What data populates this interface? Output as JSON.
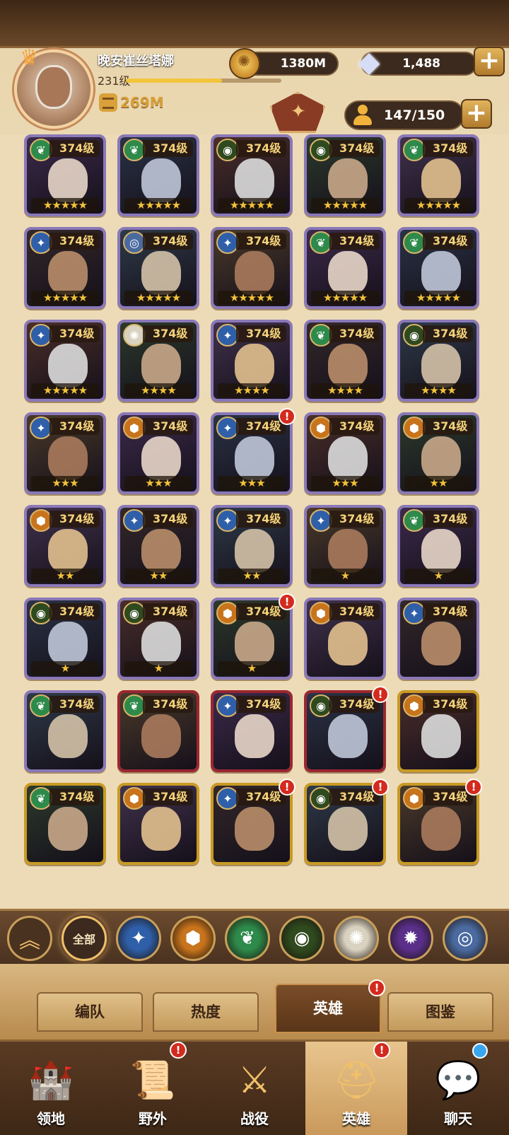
{
  "player": {
    "name": "晚安崔丝塔娜",
    "level": "231级",
    "xp_fraction": 0.62,
    "power": "269M"
  },
  "resources": {
    "gold": "1380M",
    "gems": "1,488"
  },
  "hero_count": "147/150",
  "colors": {
    "lightbearer": "#2f5fa8",
    "mauler": "#c8741c",
    "wilder": "#2e8a4a",
    "graveborn": "#2f4a1e",
    "celestial": "#d9d2c0",
    "hypogean": "#5a2f8a",
    "dimensional": "#4a6aa0",
    "card_bg": "#ecdbb6"
  },
  "heroes": [
    {
      "level": "374级",
      "faction": "wilder",
      "stars": "★★★★★",
      "frame": "purple",
      "alert": false
    },
    {
      "level": "374级",
      "faction": "wilder",
      "stars": "★★★★★",
      "frame": "purple",
      "alert": false
    },
    {
      "level": "374级",
      "faction": "graveborn",
      "stars": "★★★★★",
      "frame": "purple",
      "alert": false
    },
    {
      "level": "374级",
      "faction": "graveborn",
      "stars": "★★★★★",
      "frame": "purple",
      "alert": false
    },
    {
      "level": "374级",
      "faction": "wilder",
      "stars": "★★★★★",
      "frame": "purple",
      "alert": false
    },
    {
      "level": "374级",
      "faction": "lightbearer",
      "stars": "★★★★★",
      "frame": "purple",
      "alert": false
    },
    {
      "level": "374级",
      "faction": "dimensional",
      "stars": "★★★★★",
      "frame": "purple",
      "alert": false
    },
    {
      "level": "374级",
      "faction": "lightbearer",
      "stars": "★★★★★",
      "frame": "purple",
      "alert": false
    },
    {
      "level": "374级",
      "faction": "wilder",
      "stars": "★★★★★",
      "frame": "purple",
      "alert": false
    },
    {
      "level": "374级",
      "faction": "wilder",
      "stars": "★★★★★",
      "frame": "purple",
      "alert": false
    },
    {
      "level": "374级",
      "faction": "lightbearer",
      "stars": "★★★★★",
      "frame": "purple",
      "alert": false
    },
    {
      "level": "374级",
      "faction": "celestial",
      "stars": "★★★★",
      "frame": "purple",
      "alert": false
    },
    {
      "level": "374级",
      "faction": "lightbearer",
      "stars": "★★★★",
      "frame": "purple",
      "alert": false
    },
    {
      "level": "374级",
      "faction": "wilder",
      "stars": "★★★★",
      "frame": "purple",
      "alert": false
    },
    {
      "level": "374级",
      "faction": "graveborn",
      "stars": "★★★★",
      "frame": "purple",
      "alert": false
    },
    {
      "level": "374级",
      "faction": "lightbearer",
      "stars": "★★★",
      "frame": "purple",
      "alert": false
    },
    {
      "level": "374级",
      "faction": "mauler",
      "stars": "★★★",
      "frame": "purple",
      "alert": false
    },
    {
      "level": "374级",
      "faction": "lightbearer",
      "stars": "★★★",
      "frame": "purple",
      "alert": true
    },
    {
      "level": "374级",
      "faction": "mauler",
      "stars": "★★★",
      "frame": "purple",
      "alert": false
    },
    {
      "level": "374级",
      "faction": "mauler",
      "stars": "★★",
      "frame": "purple",
      "alert": false
    },
    {
      "level": "374级",
      "faction": "mauler",
      "stars": "★★",
      "frame": "purple",
      "alert": false
    },
    {
      "level": "374级",
      "faction": "lightbearer",
      "stars": "★★",
      "frame": "purple",
      "alert": false
    },
    {
      "level": "374级",
      "faction": "lightbearer",
      "stars": "★★",
      "frame": "purple",
      "alert": false
    },
    {
      "level": "374级",
      "faction": "lightbearer",
      "stars": "★",
      "frame": "purple",
      "alert": false
    },
    {
      "level": "374级",
      "faction": "wilder",
      "stars": "★",
      "frame": "purple",
      "alert": false
    },
    {
      "level": "374级",
      "faction": "graveborn",
      "stars": "★",
      "frame": "purple",
      "alert": false
    },
    {
      "level": "374级",
      "faction": "graveborn",
      "stars": "★",
      "frame": "purple",
      "alert": false
    },
    {
      "level": "374级",
      "faction": "mauler",
      "stars": "★",
      "frame": "purple",
      "alert": true
    },
    {
      "level": "374级",
      "faction": "mauler",
      "stars": "",
      "frame": "purple",
      "alert": false
    },
    {
      "level": "374级",
      "faction": "lightbearer",
      "stars": "",
      "frame": "purple",
      "alert": false
    },
    {
      "level": "374级",
      "faction": "wilder",
      "stars": "",
      "frame": "purple",
      "alert": false
    },
    {
      "level": "374级",
      "faction": "wilder",
      "stars": "",
      "frame": "red",
      "alert": false
    },
    {
      "level": "374级",
      "faction": "lightbearer",
      "stars": "",
      "frame": "red",
      "alert": false
    },
    {
      "level": "374级",
      "faction": "graveborn",
      "stars": "",
      "frame": "red",
      "alert": true
    },
    {
      "level": "374级",
      "faction": "mauler",
      "stars": "",
      "frame": "gold",
      "alert": false
    },
    {
      "level": "374级",
      "faction": "wilder",
      "stars": "",
      "frame": "gold",
      "alert": false
    },
    {
      "level": "374级",
      "faction": "mauler",
      "stars": "",
      "frame": "gold",
      "alert": false
    },
    {
      "level": "374级",
      "faction": "lightbearer",
      "stars": "",
      "frame": "gold",
      "alert": true
    },
    {
      "level": "374级",
      "faction": "graveborn",
      "stars": "",
      "frame": "gold",
      "alert": true
    },
    {
      "level": "374级",
      "faction": "mauler",
      "stars": "",
      "frame": "gold",
      "alert": true
    }
  ],
  "faction_filters": [
    {
      "label": "",
      "icon": "collapse-chevron-icon",
      "kind": "collapse"
    },
    {
      "label": "全部",
      "icon": "",
      "kind": "all"
    },
    {
      "label": "",
      "icon": "lightbearer-icon",
      "kind": "lightbearer"
    },
    {
      "label": "",
      "icon": "mauler-icon",
      "kind": "mauler"
    },
    {
      "label": "",
      "icon": "wilder-icon",
      "kind": "wilder"
    },
    {
      "label": "",
      "icon": "graveborn-icon",
      "kind": "graveborn"
    },
    {
      "label": "",
      "icon": "celestial-icon",
      "kind": "celestial"
    },
    {
      "label": "",
      "icon": "hypogean-icon",
      "kind": "hypogean"
    },
    {
      "label": "",
      "icon": "dimensional-icon",
      "kind": "dimensional"
    }
  ],
  "subtabs": [
    {
      "label": "编队",
      "active": false,
      "alert": false
    },
    {
      "label": "热度",
      "active": false,
      "alert": false
    },
    {
      "label": "英雄",
      "active": true,
      "alert": true
    },
    {
      "label": "图鉴",
      "active": false,
      "alert": false
    }
  ],
  "nav": [
    {
      "label": "领地",
      "icon": "castle-icon",
      "active": false,
      "alert": false,
      "blue": false
    },
    {
      "label": "野外",
      "icon": "scroll-map-icon",
      "active": false,
      "alert": true,
      "blue": false
    },
    {
      "label": "战役",
      "icon": "sword-shield-icon",
      "active": false,
      "alert": false,
      "blue": false
    },
    {
      "label": "英雄",
      "icon": "helmet-icon",
      "active": true,
      "alert": true,
      "blue": false
    },
    {
      "label": "聊天",
      "icon": "chat-bubble-icon",
      "active": false,
      "alert": false,
      "blue": true
    }
  ],
  "alert_symbol": "!",
  "plus_symbol": "+"
}
